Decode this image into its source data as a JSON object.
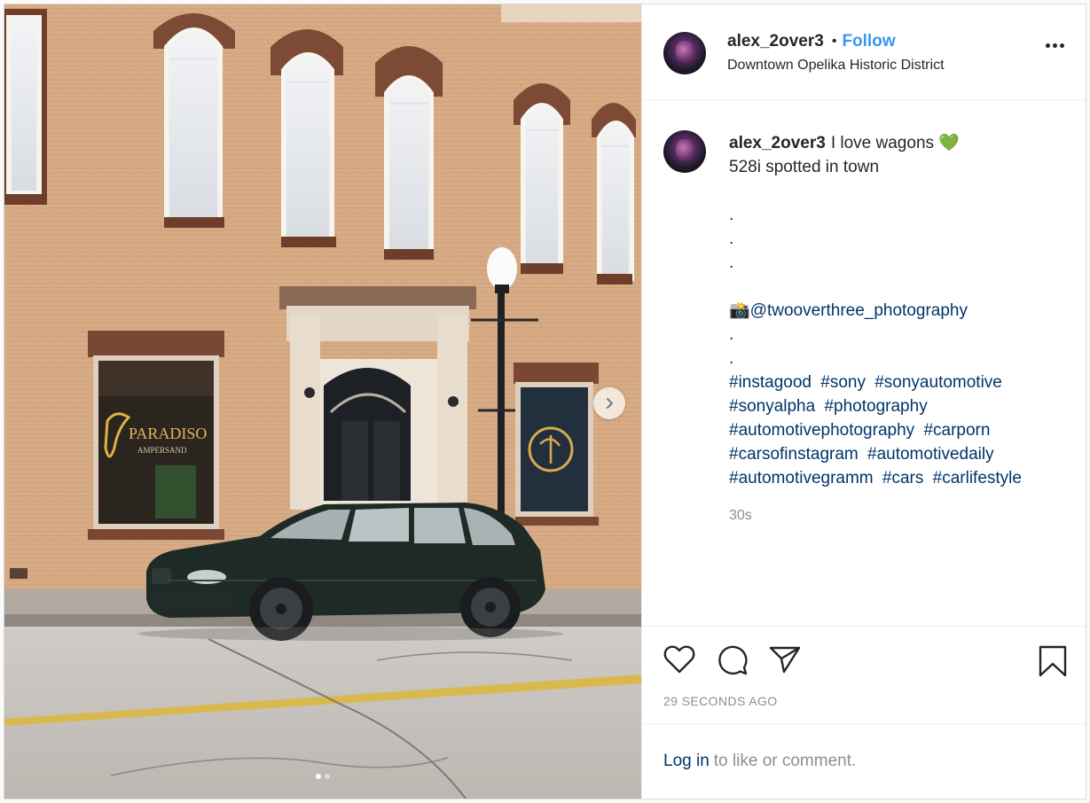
{
  "post": {
    "username": "alex_2over3",
    "separator": "•",
    "follow_label": "Follow",
    "location": "Downtown Opelika Historic District",
    "caption": {
      "username": "alex_2over3",
      "text": "I love wagons 💚\n528i spotted in town\n\n.\n.\n.\n\n📸@twooverthree_photography\n.\n."
    },
    "hashtags": [
      "#instagood",
      "#sony",
      "#sonyautomotive",
      "#sonyalpha",
      "#photography",
      "#automotivephotography",
      "#carporn",
      "#carsofinstagram",
      "#automotivedaily",
      "#automotivegramm",
      "#cars",
      "#carlifestyle"
    ],
    "comment_time": "30s",
    "posted_ago": "29 SECONDS AGO",
    "login_link": "Log in",
    "login_text": "to like or comment.",
    "carousel": {
      "total_slides": 2,
      "active_slide": 1
    }
  },
  "icons": {
    "like": "heart-icon",
    "comment": "comment-icon",
    "share": "send-icon",
    "save": "bookmark-icon",
    "more": "more-options-icon",
    "next": "chevron-right-icon"
  },
  "colors": {
    "link_blue": "#3897f0",
    "hashtag": "#003569",
    "muted": "#8e8e8e",
    "text": "#262626"
  }
}
